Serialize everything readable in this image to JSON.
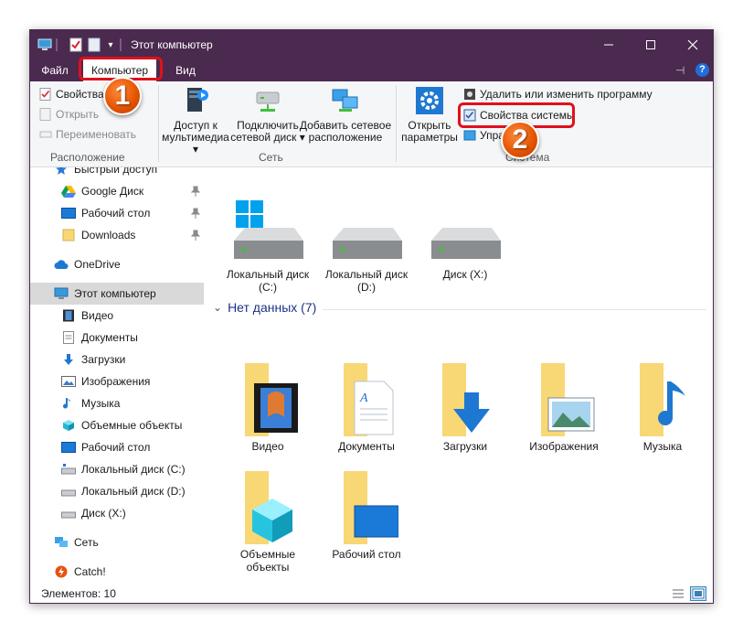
{
  "window": {
    "title": "Этот компьютер"
  },
  "tabs": [
    "Файл",
    "Компьютер",
    "Вид"
  ],
  "ribbon": {
    "location": {
      "properties": "Свойства",
      "open": "Открыть",
      "rename": "Переименовать",
      "group_label": "Расположение"
    },
    "network": {
      "media_access_l1": "Доступ к",
      "media_access_l2": "мультимедиа",
      "map_drive_l1": "Подключить",
      "map_drive_l2": "сетевой диск",
      "add_location_l1": "Добавить сетевое",
      "add_location_l2": "расположение",
      "group_label": "Сеть"
    },
    "system": {
      "open_settings_l1": "Открыть",
      "open_settings_l2": "параметры",
      "uninstall": "Удалить или изменить программу",
      "system_properties": "Свойства системы",
      "manage": "Упра",
      "group_label": "Система"
    }
  },
  "annotations": {
    "step1": "1",
    "step2": "2"
  },
  "nav": {
    "quick_access": "Быстрый доступ",
    "google_drive": "Google Диск",
    "desktop_pinned": "Рабочий стол",
    "downloads_pinned": "Downloads",
    "onedrive": "OneDrive",
    "this_pc": "Этот компьютер",
    "video": "Видео",
    "documents": "Документы",
    "downloads": "Загрузки",
    "pictures": "Изображения",
    "music": "Музыка",
    "objects3d": "Объемные объекты",
    "desktop": "Рабочий стол",
    "disk_c": "Локальный диск (C:)",
    "disk_d": "Локальный диск (D:)",
    "disk_x": "Диск (X:)",
    "network": "Сеть",
    "catch": "Catch!"
  },
  "drives": [
    {
      "label1": "Локальный диск",
      "label2": "(C:)"
    },
    {
      "label1": "Локальный диск",
      "label2": "(D:)"
    },
    {
      "label1": "Диск (X:)",
      "label2": ""
    }
  ],
  "folders_section": {
    "title": "Нет данных (7)"
  },
  "folders": [
    {
      "label1": "Видео",
      "label2": ""
    },
    {
      "label1": "Документы",
      "label2": ""
    },
    {
      "label1": "Загрузки",
      "label2": ""
    },
    {
      "label1": "Изображения",
      "label2": ""
    },
    {
      "label1": "Музыка",
      "label2": ""
    },
    {
      "label1": "Объемные",
      "label2": "объекты"
    },
    {
      "label1": "Рабочий стол",
      "label2": ""
    }
  ],
  "status": {
    "items_count": "Элементов: 10"
  },
  "colors": {
    "titlebar": "#4b2a4f",
    "highlight": "#e0101c",
    "badge": "#e35200",
    "folder": "#f8d775"
  }
}
